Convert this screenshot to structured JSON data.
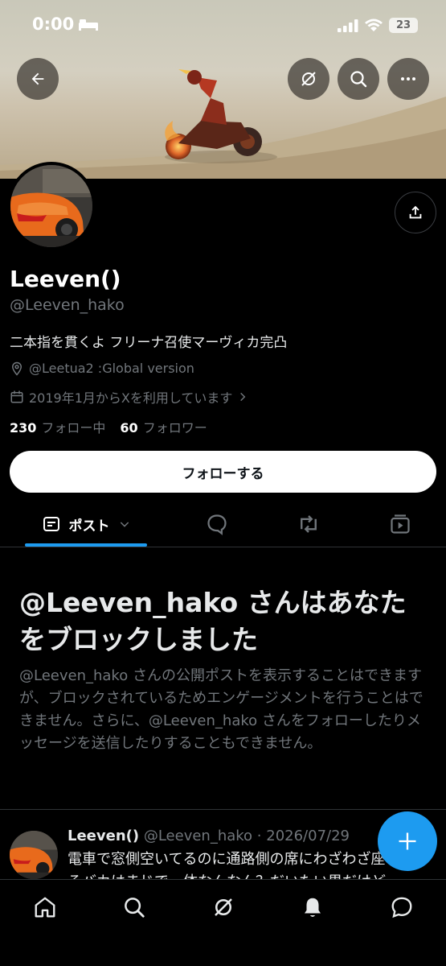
{
  "status_bar": {
    "time": "0:00",
    "battery": "23"
  },
  "profile": {
    "display_name": "Leeven()",
    "handle": "@Leeven_hako",
    "bio": "二本指を貫くよ フリーナ召使マーヴィカ完凸",
    "location": "@Leetua2 :Global version",
    "joined": "2019年1月からXを利用しています",
    "following_count": "230",
    "following_label": "フォロー中",
    "followers_count": "60",
    "followers_label": "フォロワー",
    "follow_button": "フォローする"
  },
  "tabs": [
    {
      "label": "ポスト",
      "icon": "post-icon",
      "active": true
    },
    {
      "label": "",
      "icon": "replies-icon"
    },
    {
      "label": "",
      "icon": "repost-icon"
    },
    {
      "label": "",
      "icon": "media-icon"
    }
  ],
  "block_notice": {
    "title": "@Leeven_hako さんはあなたをブロックしました",
    "description": "@Leeven_hako さんの公開ポストを表示することはできますが、ブロックされているためエンゲージメントを行うことはできません。さらに、@Leeven_hako さんをフォローしたりメッセージを送信したりすることもできません。"
  },
  "post": {
    "name": "Leeven()",
    "handle_date": "@Leeven_hako · 2026/07/29",
    "text_line1": "電車で窓側空いてるのに通路側の席にわざわざ座",
    "text_line2": "るバカはまじで一体なんなん？だいたい男だけど"
  },
  "colors": {
    "accent": "#1d9bf0",
    "background": "#000000",
    "muted": "#71767b"
  },
  "bottom_nav": [
    "home-icon",
    "search-icon",
    "grok-icon",
    "notifications-icon",
    "messages-icon"
  ]
}
